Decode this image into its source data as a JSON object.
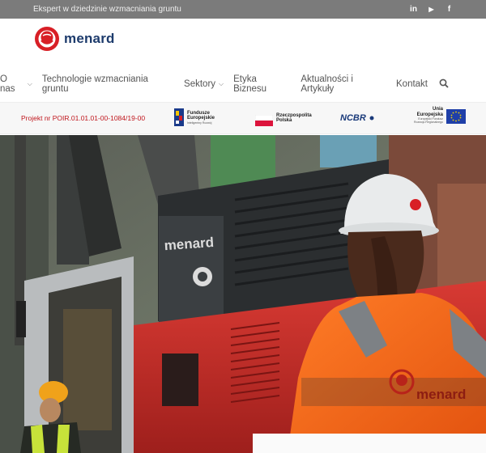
{
  "topbar": {
    "tagline": "Ekspert w dziedzinie wzmacniania gruntu",
    "social": [
      {
        "icon": "linkedin-icon",
        "glyph": "in"
      },
      {
        "icon": "youtube-icon",
        "glyph": "▶"
      },
      {
        "icon": "facebook-icon",
        "glyph": "f"
      }
    ]
  },
  "header": {
    "logo_text": "menard",
    "nav": [
      {
        "label": "O nas",
        "has_dropdown": true
      },
      {
        "label": "Technologie wzmacniania gruntu",
        "has_dropdown": false
      },
      {
        "label": "Sektory",
        "has_dropdown": true
      },
      {
        "label": "Etyka Biznesu",
        "has_dropdown": false
      },
      {
        "label": "Aktualności i Artykuły",
        "has_dropdown": false
      },
      {
        "label": "Kontakt",
        "has_dropdown": false
      }
    ]
  },
  "project": {
    "prefix": "Projekt nr",
    "number": "POIR.01.01.01-00-1084/19-00",
    "funds_title": "Fundusze Europejskie",
    "funds_sub": "Inteligentny Rozwój",
    "poland_title": "Rzeczpospolita Polska",
    "ncbr": "NCBR",
    "eu_title": "Unia Europejska",
    "eu_sub": "Europejski Fundusz Rozwoju Regionalnego"
  },
  "hero": {
    "machine_brand": "menard",
    "vest_brand": "menard"
  },
  "colors": {
    "brand_red": "#d81f26",
    "brand_navy": "#1d3b6c",
    "project_red": "#c0161d",
    "topbar_gray": "#7b7b7b",
    "vest_orange": "#f26a1b"
  }
}
